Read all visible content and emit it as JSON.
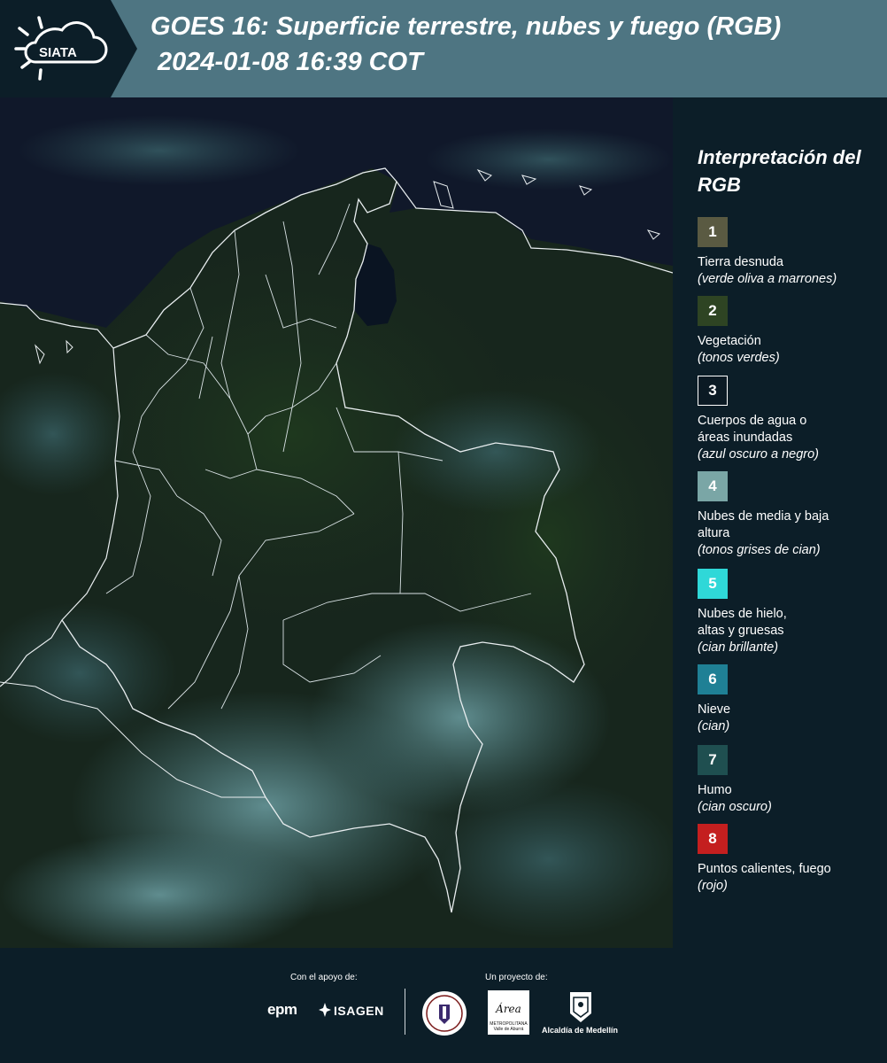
{
  "header": {
    "logo_text": "SIATA",
    "title_line1": "GOES 16: Superficie terrestre, nubes y fuego (RGB)",
    "title_line2": "2024-01-08 16:39 COT"
  },
  "legend": {
    "title": "Interpretación del RGB",
    "items": [
      {
        "number": "1",
        "label": "Tierra desnuda",
        "sub": "(verde oliva a marrones)",
        "color": "#5a5a42"
      },
      {
        "number": "2",
        "label": "Vegetación",
        "sub": "(tonos verdes)",
        "color": "#2e4423"
      },
      {
        "number": "3",
        "label": "Cuerpos de agua o áreas inundadas",
        "sub": "(azul oscuro a negro)",
        "color": "#0b1a24"
      },
      {
        "number": "4",
        "label": "Nubes de media y baja altura",
        "sub": "(tonos grises de cian)",
        "color": "#7aa6a6"
      },
      {
        "number": "5",
        "label": "Nubes de hielo, altas y gruesas",
        "sub": "(cian brillante)",
        "color": "#2fd8d8"
      },
      {
        "number": "6",
        "label": "Nieve",
        "sub": "(cian)",
        "color": "#1f8095"
      },
      {
        "number": "7",
        "label": "Humo",
        "sub": "(cian oscuro)",
        "color": "#1f4f50"
      },
      {
        "number": "8",
        "label": "Puntos calientes, fuego",
        "sub": "(rojo)",
        "color": "#c41f1f"
      }
    ]
  },
  "footer": {
    "support_label": "Con el apoyo de:",
    "project_label": "Un proyecto de:",
    "sponsor1": "epm",
    "sponsor2": "ISAGEN",
    "partner_area": "Área",
    "partner_area_sub": "METROPOLITANA Valle de Aburrá",
    "partner_medellin": "Alcaldía de Medellín"
  }
}
